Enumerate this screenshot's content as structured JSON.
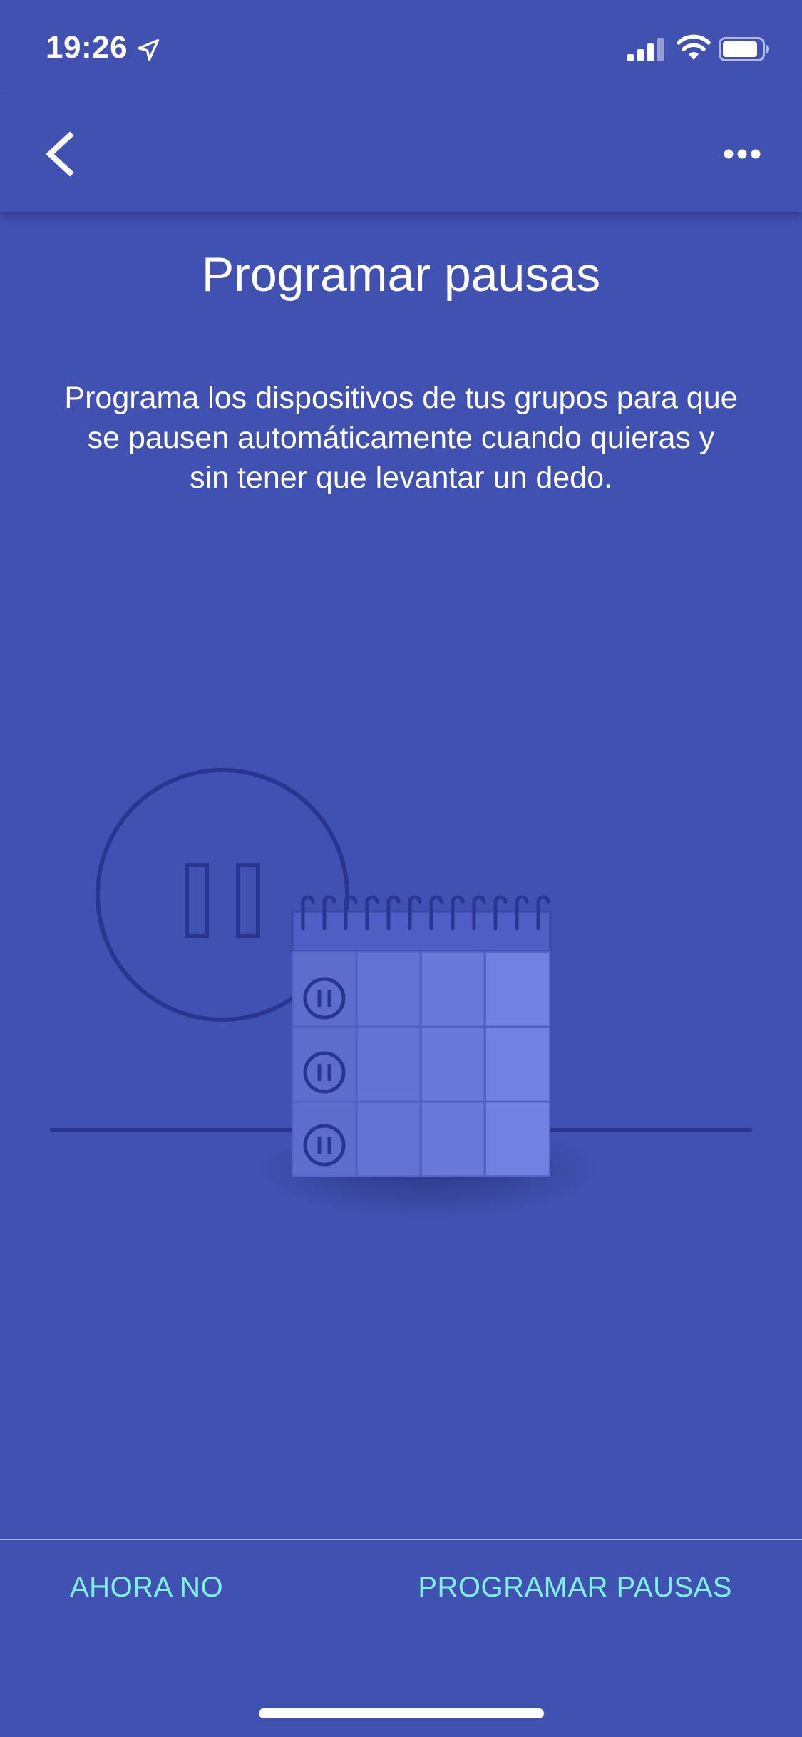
{
  "status_bar": {
    "time": "19:26",
    "icons": [
      "location-arrow-icon",
      "cellular-signal-icon",
      "wifi-icon",
      "battery-icon"
    ]
  },
  "app_bar": {
    "back_icon": "chevron-left-icon",
    "more_icon": "more-horizontal-icon"
  },
  "main": {
    "title": "Programar pausas",
    "description": "Programa los dispositivos de tus grupos para que se pausen automáticamente cuando quieras y sin tener que levantar un dedo."
  },
  "illustration": {
    "icons": [
      "pause-circle-icon",
      "calendar-icon"
    ]
  },
  "footer": {
    "secondary_button": "AHORA NO",
    "primary_button": "PROGRAMAR PAUSAS"
  },
  "colors": {
    "background": "#4151b1",
    "accent_text": "#7ff0e6",
    "illustration_stroke": "#2a3590"
  }
}
